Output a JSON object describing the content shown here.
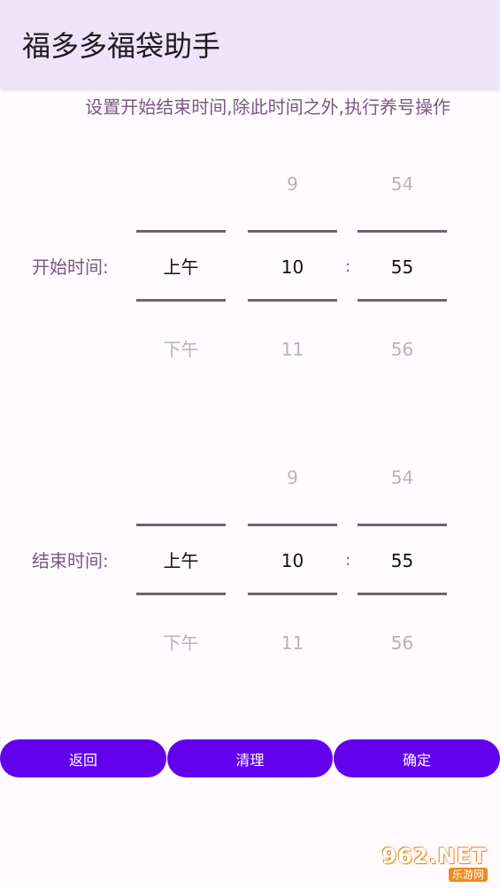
{
  "app": {
    "title": "福多多福袋助手"
  },
  "instruction": "设置开始结束时间,除此时间之外,执行养号操作",
  "start": {
    "label": "开始时间:",
    "ampm": {
      "selected": "上午",
      "next": "下午"
    },
    "hour": {
      "prev": "9",
      "selected": "10",
      "next": "11"
    },
    "colon": ":",
    "minute": {
      "prev": "54",
      "selected": "55",
      "next": "56"
    }
  },
  "end": {
    "label": "结束时间:",
    "ampm": {
      "selected": "上午",
      "next": "下午"
    },
    "hour": {
      "prev": "9",
      "selected": "10",
      "next": "11"
    },
    "colon": ":",
    "minute": {
      "prev": "54",
      "selected": "55",
      "next": "56"
    }
  },
  "buttons": {
    "back": "返回",
    "clear": "清理",
    "confirm": "确定"
  },
  "watermark": {
    "logo": "962.NET",
    "sub": "乐游网"
  },
  "colors": {
    "accent": "#6200ee",
    "appbar": "#efe5fa",
    "label": "#7a5a82"
  }
}
